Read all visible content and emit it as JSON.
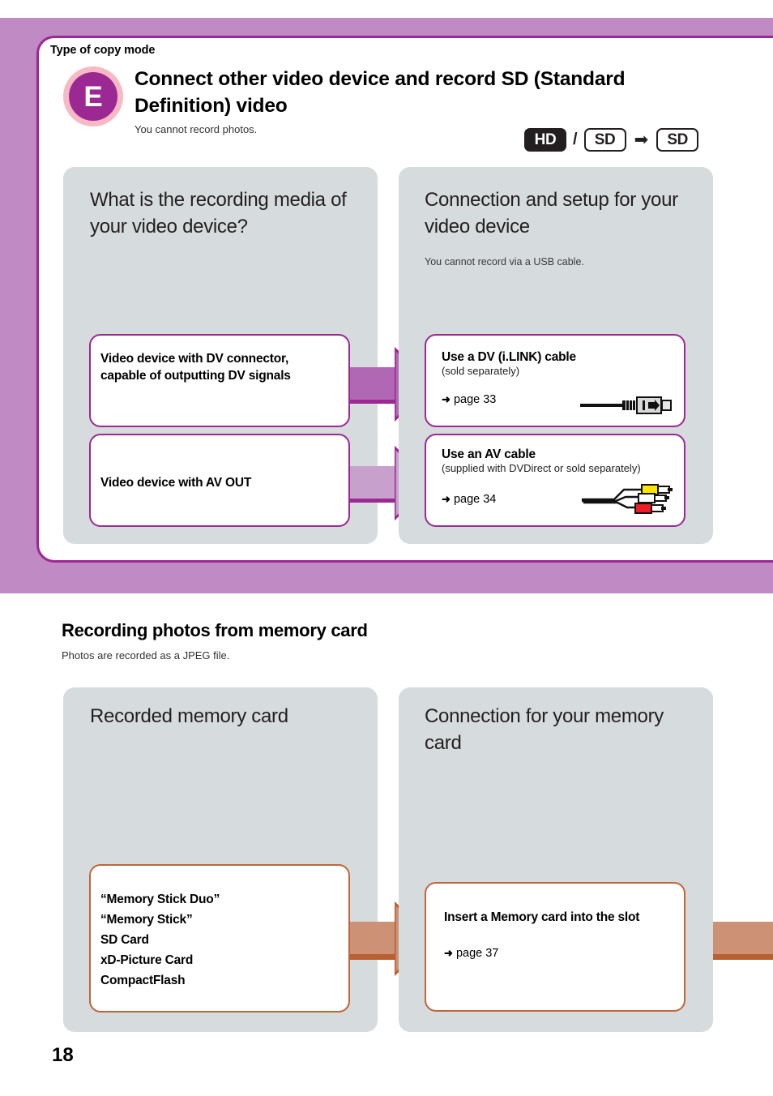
{
  "page": {
    "number": "18",
    "copy_mode_label": "Type of copy mode",
    "mode_letter": "E"
  },
  "header": {
    "title": "Connect other video device and record SD (Standard Definition) video",
    "subtitle": "You cannot record photos.",
    "badges": {
      "source_hd": "HD",
      "slash": "/",
      "source_sd": "SD",
      "arrow": "➡",
      "target_sd": "SD"
    }
  },
  "section1": {
    "left_panel": {
      "title": "What is the recording media of your video device?",
      "boxes": [
        {
          "text": "Video device with DV connector, capable of outputting DV signals"
        },
        {
          "text": "Video device with AV OUT"
        }
      ]
    },
    "right_panel": {
      "title": "Connection and setup for your video device",
      "subtitle": "You cannot record via a USB cable.",
      "boxes": [
        {
          "title": "Use a DV (i.LINK) cable",
          "note": "(sold separately)",
          "page_ref": "page 33",
          "arrow": "➜",
          "icon": "dv-cable-icon"
        },
        {
          "title": "Use an AV cable",
          "note": "(supplied with DVDirect or sold separately)",
          "page_ref": "page 34",
          "arrow": "➜",
          "icon": "av-cable-icon"
        }
      ]
    }
  },
  "section2": {
    "title": "Recording photos from memory card",
    "subtitle": "Photos are recorded as a JPEG file.",
    "left_panel": {
      "title": "Recorded memory card",
      "box_text": "“Memory Stick Duo”\n“Memory Stick”\nSD Card\nxD-Picture Card\nCompactFlash"
    },
    "right_panel": {
      "title": "Connection for your memory card",
      "box": {
        "title": "Insert a Memory card into the slot",
        "page_ref": "page 37",
        "arrow": "➜"
      }
    }
  },
  "colors": {
    "band_purple": "#c08ac4",
    "border_purple": "#9c2894",
    "arrow_purple_dark": "#b168b4",
    "arrow_purple_light": "#c8a0cc",
    "panel_gray": "#d6dbdd",
    "orange_border": "#c0653c",
    "orange_fill": "#cd9176",
    "badge_ring_pink": "#f7b9c4"
  }
}
